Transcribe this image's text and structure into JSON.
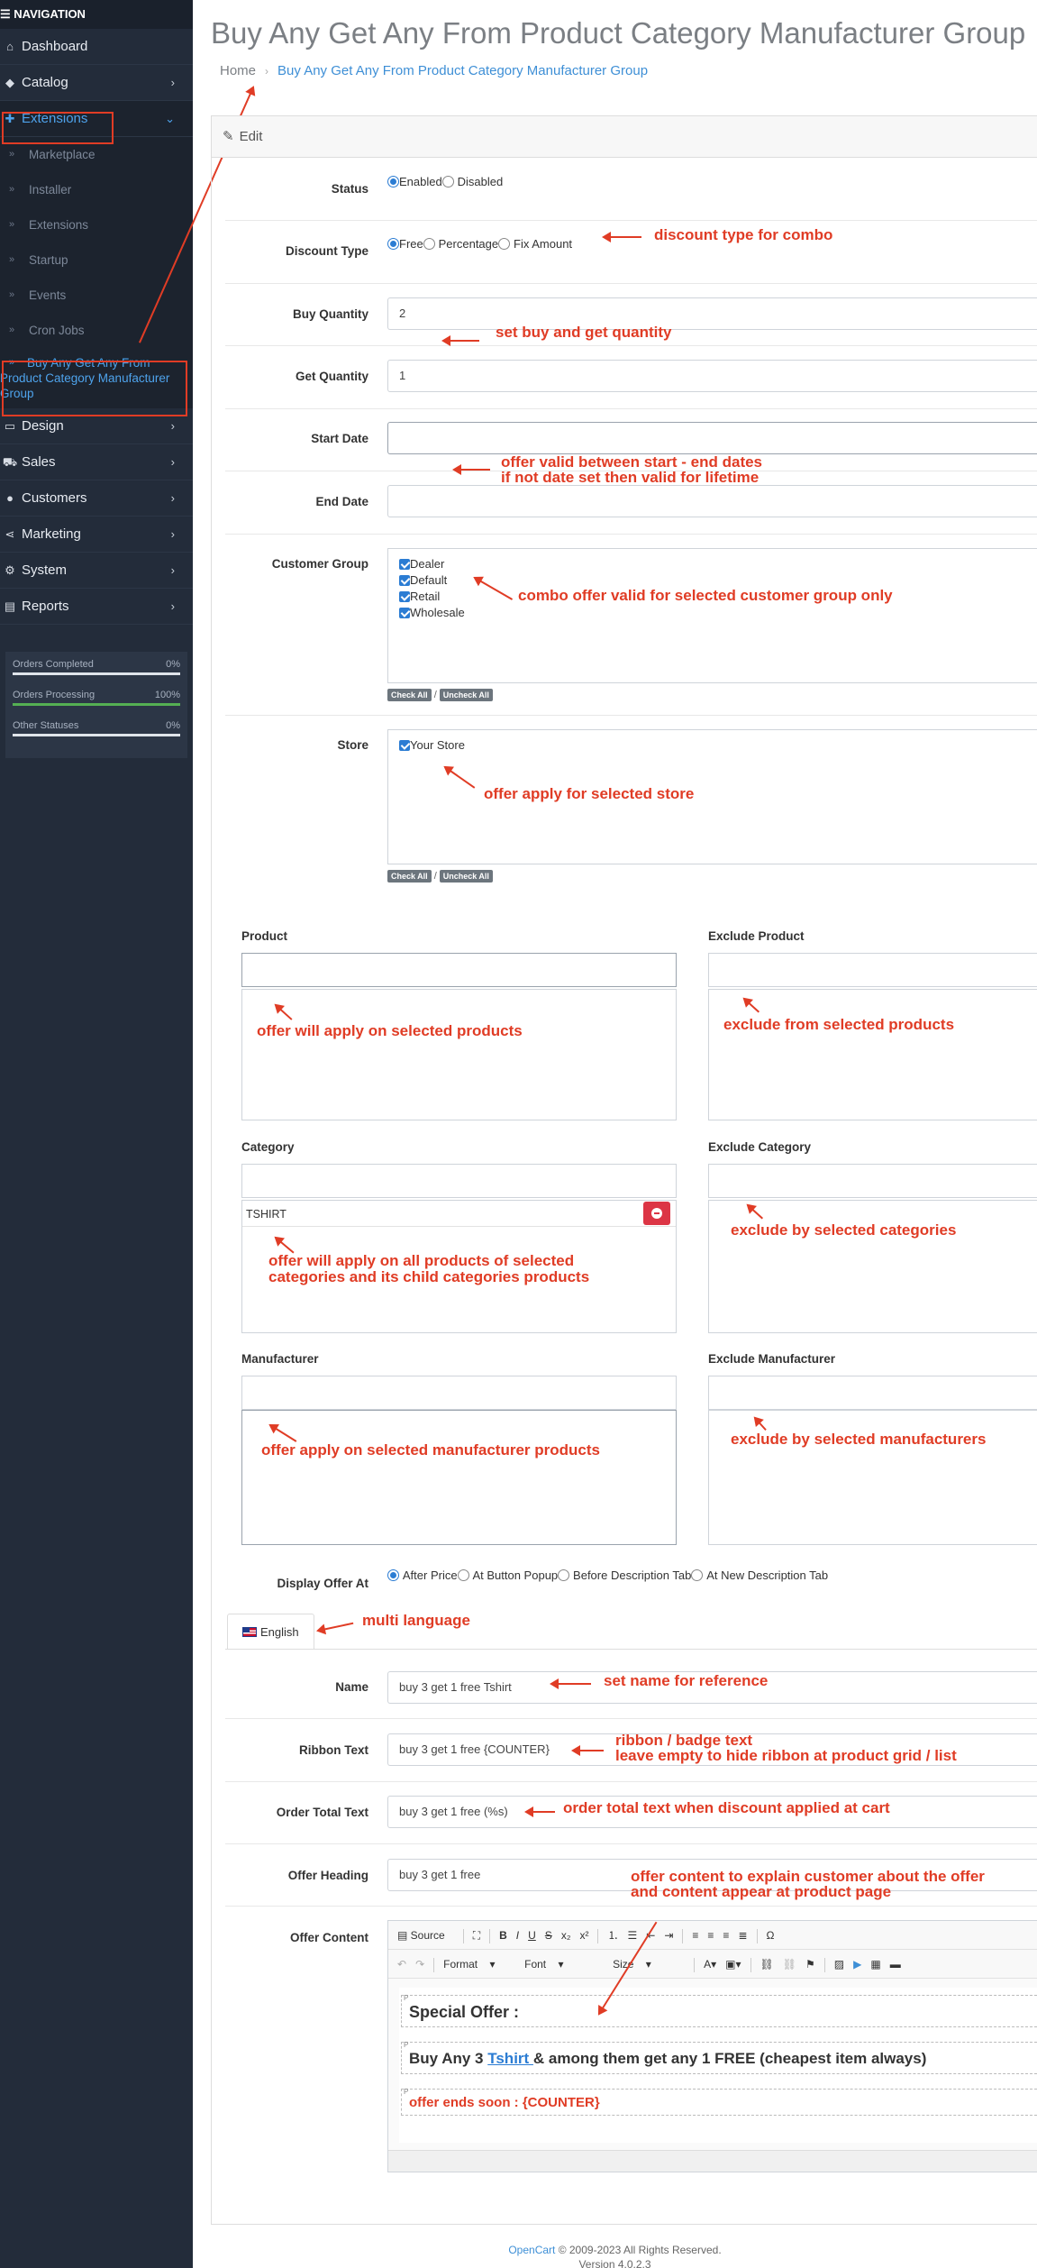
{
  "sidebar": {
    "header": "☰ NAVIGATION",
    "items": [
      {
        "label": "Dashboard",
        "icon": "home-icon"
      },
      {
        "label": "Catalog",
        "icon": "tag-icon"
      },
      {
        "label": "Extensions",
        "icon": "puzzle-icon"
      },
      {
        "label": "Design",
        "icon": "desktop-icon"
      },
      {
        "label": "Sales",
        "icon": "cart-icon"
      },
      {
        "label": "Customers",
        "icon": "user-icon"
      },
      {
        "label": "Marketing",
        "icon": "share-icon"
      },
      {
        "label": "System",
        "icon": "gear-icon"
      },
      {
        "label": "Reports",
        "icon": "chart-icon"
      }
    ],
    "sub_items": [
      "Marketplace",
      "Installer",
      "Extensions",
      "Startup",
      "Events",
      "Cron Jobs"
    ],
    "current_sub": "Buy Any Get Any From Product Category Manufacturer Group",
    "stats": [
      {
        "label": "Orders Completed",
        "pct": "0%",
        "fill": 0
      },
      {
        "label": "Orders Processing",
        "pct": "100%",
        "fill": 1
      },
      {
        "label": "Other Statuses",
        "pct": "0%",
        "fill": 0
      }
    ]
  },
  "page": {
    "title": "Buy Any Get Any From Product Category Manufacturer Group",
    "breadcrumb_home": "Home",
    "breadcrumb_current": "Buy Any Get Any From Product Category Manufacturer Group",
    "card_header": "Edit"
  },
  "form": {
    "status_label": "Status",
    "status_enabled": "Enabled",
    "status_disabled": "Disabled",
    "discount_type_label": "Discount Type",
    "discount_free": "Free",
    "discount_percentage": "Percentage",
    "discount_fix": "Fix Amount",
    "buy_qty_label": "Buy Quantity",
    "buy_qty_value": "2",
    "get_qty_label": "Get Quantity",
    "get_qty_value": "1",
    "start_date_label": "Start Date",
    "end_date_label": "End Date",
    "customer_group_label": "Customer Group",
    "customer_groups": [
      "Dealer",
      "Default",
      "Retail",
      "Wholesale"
    ],
    "check_all": "Check All",
    "uncheck_all": "Uncheck All",
    "slash": "/",
    "store_label": "Store",
    "stores": [
      "Your Store"
    ],
    "product_label": "Product",
    "exclude_product_label": "Exclude Product",
    "category_label": "Category",
    "exclude_category_label": "Exclude Category",
    "category_selected": "TSHIRT",
    "manufacturer_label": "Manufacturer",
    "exclude_manufacturer_label": "Exclude Manufacturer",
    "display_offer_label": "Display Offer At",
    "display_after_price": "After Price",
    "display_button_popup": "At Button Popup",
    "display_before_desc": "Before Description Tab",
    "display_new_desc": "At New Description Tab",
    "lang_tab": "English",
    "name_label": "Name",
    "name_value": "buy 3 get 1 free Tshirt",
    "ribbon_label": "Ribbon Text",
    "ribbon_value": "buy 3 get 1 free {COUNTER}",
    "order_total_label": "Order Total Text",
    "order_total_value": "buy 3 get 1 free (%s)",
    "offer_heading_label": "Offer Heading",
    "offer_heading_value": "buy 3 get 1 free",
    "offer_content_label": "Offer Content"
  },
  "editor": {
    "source": "Source",
    "format": "Format",
    "font": "Font",
    "size": "Size",
    "para1": "Special Offer :",
    "para2_pre": "Buy Any 3 ",
    "para2_link": "Tshirt ",
    "para2_post": "& among them get any 1 FREE (cheapest item always)",
    "para3": "offer ends soon : {COUNTER}"
  },
  "annotations": {
    "discount": "discount type for combo",
    "quantity": "set buy and get quantity",
    "dates_1": "offer valid between start - end dates",
    "dates_2": "if not date set then valid for lifetime",
    "customer": "combo offer valid for selected customer group only",
    "store": "offer apply for selected store",
    "product": "offer will apply on selected products",
    "exclude_product": "exclude from selected products",
    "category_1": "offer will apply on all products of selected",
    "category_2": "categories and its child categories products",
    "exclude_category": "exclude by selected categories",
    "manufacturer": "offer apply on selected manufacturer products",
    "exclude_manufacturer": "exclude by selected manufacturers",
    "language": "multi language",
    "name": "set name for reference",
    "ribbon_1": "ribbon / badge text",
    "ribbon_2": "leave empty to hide ribbon at product grid / list",
    "order_total": "order total text when discount applied at cart",
    "content_1": "offer content to explain customer about the offer",
    "content_2": "and content appear at product page"
  },
  "footer": {
    "brand": "OpenCart",
    "copyright": " © 2009-2023 All Rights Reserved.",
    "version": "Version 4.0.2.3"
  },
  "colors": {
    "sidebar_bg": "#232c3a",
    "accent": "#3e8fd6",
    "annotation": "#e03c25"
  }
}
